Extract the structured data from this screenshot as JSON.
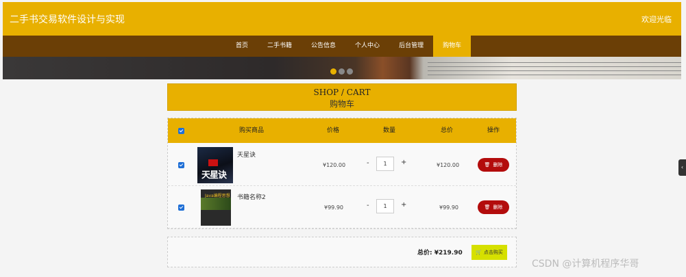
{
  "header": {
    "site_title": "二手书交易软件设计与实现",
    "welcome": "欢迎光临"
  },
  "nav": {
    "items": [
      "首页",
      "二手书籍",
      "公告信息",
      "个人中心",
      "后台管理",
      "购物车"
    ],
    "active_index": 5
  },
  "cart_title": {
    "en": "SHOP / CART",
    "cn": "购物车"
  },
  "table": {
    "headers": {
      "product": "购买商品",
      "price": "价格",
      "quantity": "数量",
      "total": "总价",
      "action": "操作"
    },
    "rows": [
      {
        "name": "天星诀",
        "price": "¥120.00",
        "quantity": "1",
        "total": "¥120.00",
        "delete_label": "删除",
        "cover_text": "天星诀"
      },
      {
        "name": "书籍名称2",
        "price": "¥99.90",
        "quantity": "1",
        "total": "¥99.90",
        "delete_label": "删除",
        "cover_text": "Java编程思想"
      }
    ],
    "minus": "-",
    "plus": "+"
  },
  "summary": {
    "label": "总价:",
    "value": "¥219.90",
    "buy_label": "点击购买"
  },
  "watermark": "CSDN @计算机程序华哥",
  "colors": {
    "accent": "#e8b000",
    "nav_bg": "#6b3f06",
    "delete": "#b30c0c",
    "buy": "#d6e000"
  }
}
